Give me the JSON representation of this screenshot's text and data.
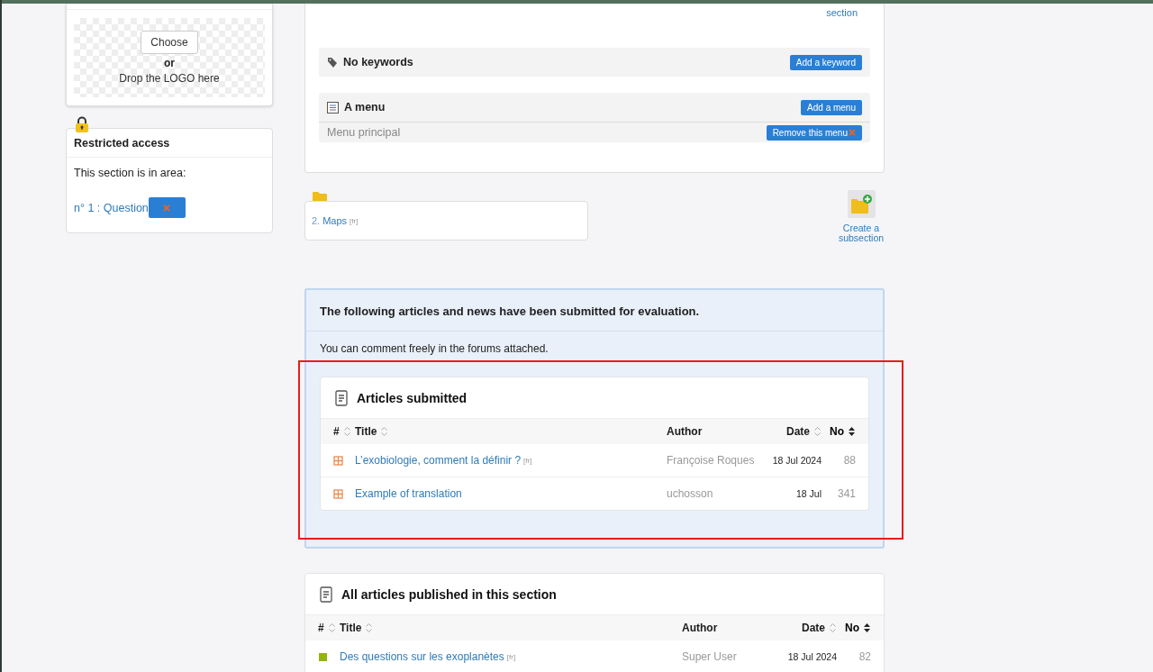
{
  "logo_upload": {
    "button": "Choose",
    "separator": "or",
    "hint": "Drop the LOGO here"
  },
  "restricted_access": {
    "title": "Restricted access",
    "text": "This section is in area:",
    "area_link": "n° 1 : Question"
  },
  "edit_link": "section",
  "keywords": {
    "title": "No keywords",
    "button": "Add a keyword"
  },
  "menus": {
    "title": "A menu",
    "button": "Add a menu",
    "items": [
      {
        "name": "Menu principal",
        "button": "Remove this menu"
      }
    ]
  },
  "subsections": [
    {
      "number": "2.",
      "title": "Maps",
      "lang": "[fr]"
    }
  ],
  "create_subsection": "Create a subsection",
  "evaluation": {
    "heading": "The following articles and news have been submitted for evaluation.",
    "note": "You can comment freely in the forums attached.",
    "table": {
      "title": "Articles submitted",
      "highlighted": true,
      "columns": [
        {
          "label": "#",
          "sortable": true,
          "sorted": false
        },
        {
          "label": "Title",
          "sortable": true,
          "sorted": false
        },
        {
          "label": "Author",
          "sortable": false,
          "sorted": false
        },
        {
          "label": "Date",
          "sortable": true,
          "sorted": false
        },
        {
          "label": "No",
          "sortable": true,
          "sorted": true
        }
      ],
      "rows": [
        {
          "kind": "proposed",
          "title": "L’exobiologie, comment la définir ?",
          "lang": "[fr]",
          "author": "Françoise Roques",
          "date": "18 Jul 2024",
          "number": "88"
        },
        {
          "kind": "proposed",
          "title": "Example of translation",
          "author": "uchosson",
          "date": "18 Jul",
          "number": "341"
        }
      ]
    }
  },
  "published": {
    "table": {
      "title": "All articles published in this section",
      "columns": [
        {
          "label": "#",
          "sortable": true,
          "sorted": false
        },
        {
          "label": "Title",
          "sortable": true,
          "sorted": false
        },
        {
          "label": "Author",
          "sortable": false,
          "sorted": false
        },
        {
          "label": "Date",
          "sortable": true,
          "sorted": false
        },
        {
          "label": "No",
          "sortable": true,
          "sorted": true
        }
      ],
      "rows": [
        {
          "kind": "published",
          "title": "Des questions sur les exoplanètes",
          "lang": "[fr]",
          "author": "Super User",
          "date": "18 Jul 2024",
          "number": "82"
        }
      ]
    }
  }
}
